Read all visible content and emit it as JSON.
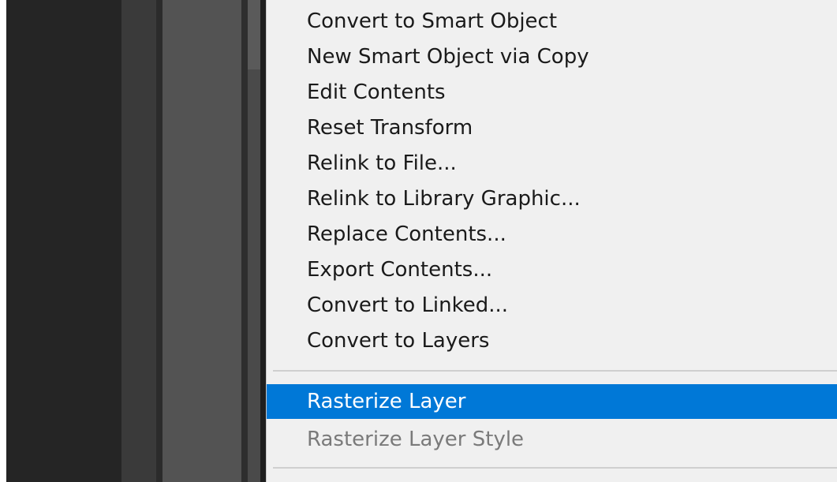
{
  "colors": {
    "menu_background": "#f0f0f0",
    "highlight": "#0078d7",
    "text": "#1a1a1a",
    "disabled_text": "#7a7a7a"
  },
  "context_menu": {
    "items": [
      {
        "label": "Convert to Smart Object",
        "state": "normal"
      },
      {
        "label": "New Smart Object via Copy",
        "state": "normal"
      },
      {
        "label": "Edit Contents",
        "state": "normal"
      },
      {
        "label": "Reset Transform",
        "state": "normal"
      },
      {
        "label": "Relink to File...",
        "state": "normal"
      },
      {
        "label": "Relink to Library Graphic...",
        "state": "normal"
      },
      {
        "label": "Replace Contents...",
        "state": "normal"
      },
      {
        "label": "Export Contents...",
        "state": "normal"
      },
      {
        "label": "Convert to Linked...",
        "state": "normal"
      },
      {
        "label": "Convert to Layers",
        "state": "normal"
      },
      {
        "label": "Rasterize Layer",
        "state": "highlighted"
      },
      {
        "label": "Rasterize Layer Style",
        "state": "disabled"
      }
    ]
  }
}
